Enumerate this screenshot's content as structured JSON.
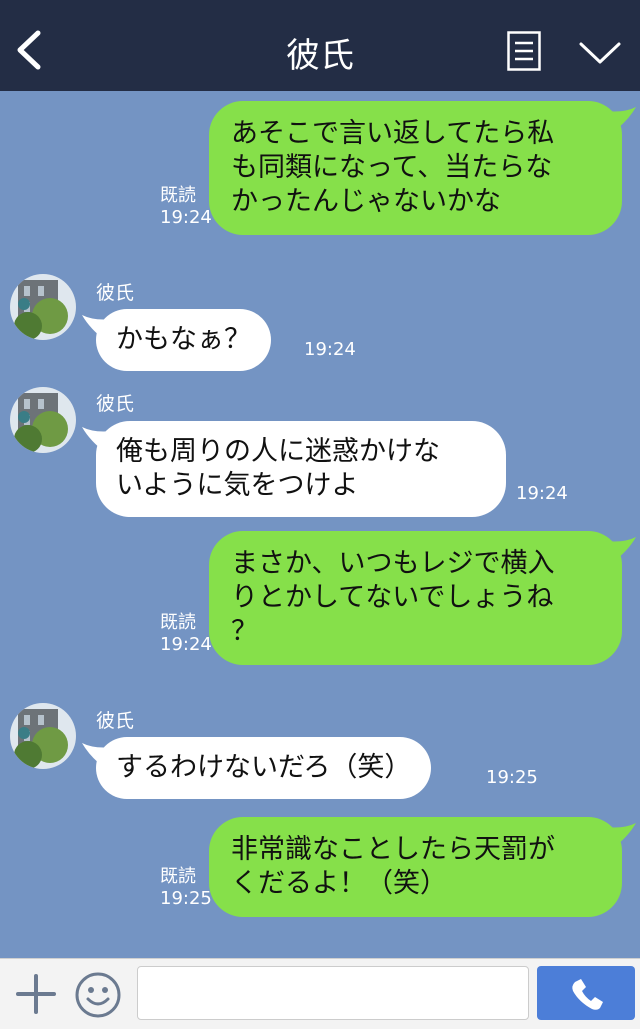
{
  "header": {
    "title": "彼氏"
  },
  "messages": [
    {
      "type": "out",
      "text_lines": [
        "あそこで言い返してたら私",
        "も同類になって、当たらな",
        "かったんじゃないかな"
      ],
      "read": "既読",
      "time": "19:24"
    },
    {
      "type": "in",
      "sender": "彼氏",
      "text_lines": [
        "かもなぁ？"
      ],
      "time": "19:24"
    },
    {
      "type": "in",
      "sender": "彼氏",
      "text_lines": [
        "俺も周りの人に迷惑かけな",
        "いように気をつけよ"
      ],
      "time": "19:24"
    },
    {
      "type": "out",
      "text_lines": [
        "まさか、いつもレジで横入",
        "りとかしてないでしょうね",
        "？"
      ],
      "read": "既読",
      "time": "19:24"
    },
    {
      "type": "in",
      "sender": "彼氏",
      "text_lines": [
        "するわけないだろ（笑）"
      ],
      "time": "19:25"
    },
    {
      "type": "out",
      "text_lines": [
        "非常識なことしたら天罰が",
        "くだるよ！（笑）"
      ],
      "read": "既読",
      "time": "19:25"
    }
  ],
  "colors": {
    "header_bg": "#232d45",
    "chat_bg": "#7494c3",
    "outgoing_bubble": "#86e04a",
    "incoming_bubble": "#ffffff",
    "call_button": "#4c7ed8"
  },
  "icons": [
    "back-arrow-icon",
    "menu-icon",
    "chevron-down-icon",
    "plus-icon",
    "smiley-icon",
    "phone-icon"
  ]
}
